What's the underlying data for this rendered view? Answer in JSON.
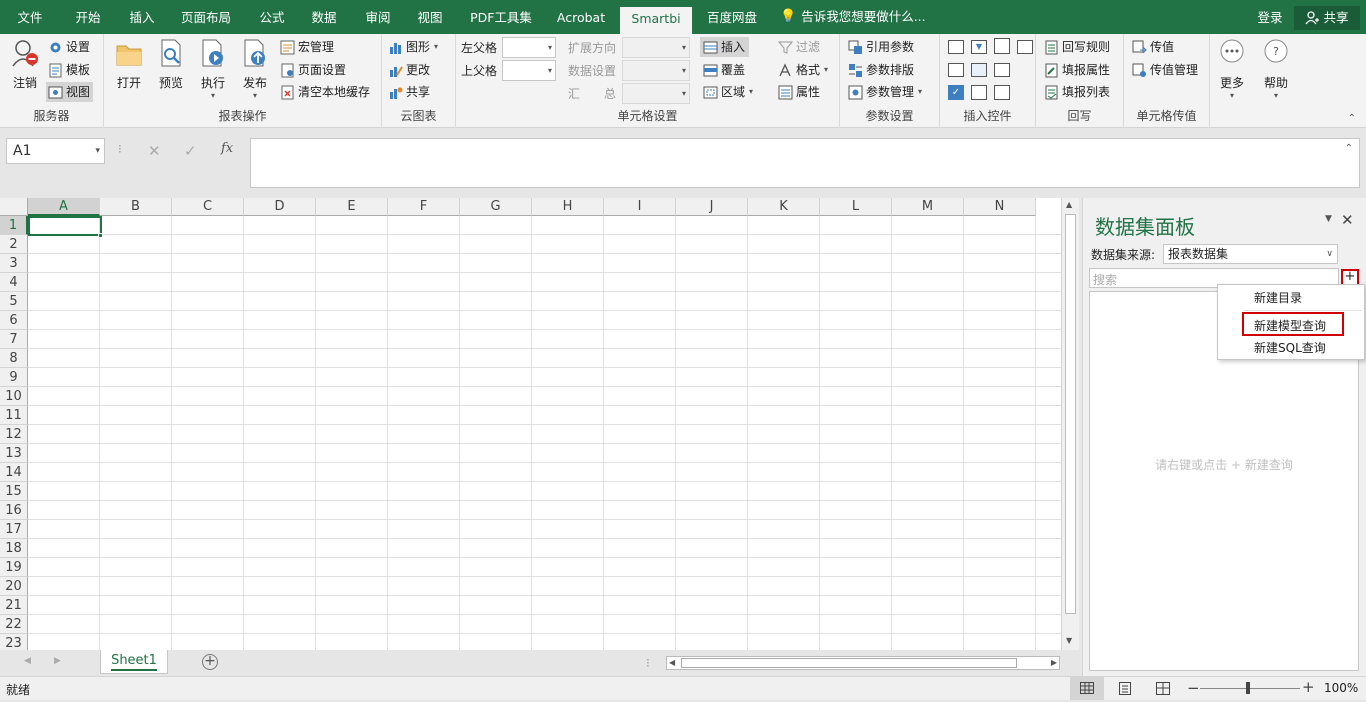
{
  "tabs": {
    "file": "文件",
    "home": "开始",
    "insert": "插入",
    "layout": "页面布局",
    "formulas": "公式",
    "data": "数据",
    "review": "审阅",
    "view": "视图",
    "pdf": "PDF工具集",
    "acrobat": "Acrobat",
    "smartbi": "Smartbi",
    "baidu": "百度网盘",
    "tell": "告诉我您想要做什么...",
    "login": "登录",
    "share": "共享"
  },
  "ribbon": {
    "server": {
      "logout": "注销",
      "settings": "设置",
      "template": "模板",
      "view": "视图",
      "label": "服务器"
    },
    "report": {
      "open": "打开",
      "preview": "预览",
      "execute": "执行",
      "publish": "发布",
      "macro": "宏管理",
      "page_setup": "页面设置",
      "clear_cache": "清空本地缓存",
      "label": "报表操作"
    },
    "cloud": {
      "chart": "图形",
      "update": "更改",
      "share": "共享",
      "label": "云图表"
    },
    "cell": {
      "left_parent": "左父格",
      "top_parent": "上父格",
      "expand_dir": "扩展方向",
      "data_setting": "数据设置",
      "summary": "汇　　总",
      "insert": "插入",
      "cover": "覆盖",
      "area": "区域",
      "filter": "过滤",
      "format": "格式",
      "property": "属性",
      "label": "单元格设置"
    },
    "param": {
      "ref_param": "引用参数",
      "param_layout": "参数排版",
      "param_manage": "参数管理",
      "label": "参数设置"
    },
    "controls": {
      "label": "插入控件"
    },
    "writeback": {
      "rules": "回写规则",
      "fill_prop": "填报属性",
      "fill_list": "填报列表",
      "label": "回写"
    },
    "cellpass": {
      "pass": "传值",
      "pass_manage": "传值管理",
      "label": "单元格传值"
    },
    "more": {
      "more": "更多",
      "help": "帮助"
    }
  },
  "formula_bar": {
    "cell_ref": "A1",
    "fx": "fx"
  },
  "grid": {
    "columns": [
      "A",
      "B",
      "C",
      "D",
      "E",
      "F",
      "G",
      "H",
      "I",
      "J",
      "K",
      "L",
      "M",
      "N"
    ],
    "rows": [
      "1",
      "2",
      "3",
      "4",
      "5",
      "6",
      "7",
      "8",
      "9",
      "10",
      "11",
      "12",
      "13",
      "14",
      "15",
      "16",
      "17",
      "18",
      "19",
      "20",
      "21",
      "22",
      "23"
    ]
  },
  "sheets": {
    "active": "Sheet1"
  },
  "status": {
    "ready": "就绪",
    "zoom": "100%"
  },
  "panel": {
    "title": "数据集面板",
    "source_label": "数据集来源:",
    "source_value": "报表数据集",
    "search_placeholder": "搜索",
    "hint": "请右键或点击 + 新建查询",
    "add": "+"
  },
  "menu": {
    "new_dir": "新建目录",
    "new_model_query": "新建模型查询",
    "new_sql_query": "新建SQL查询"
  },
  "colors": {
    "excel_green": "#217346",
    "highlight_red": "#d00000"
  }
}
